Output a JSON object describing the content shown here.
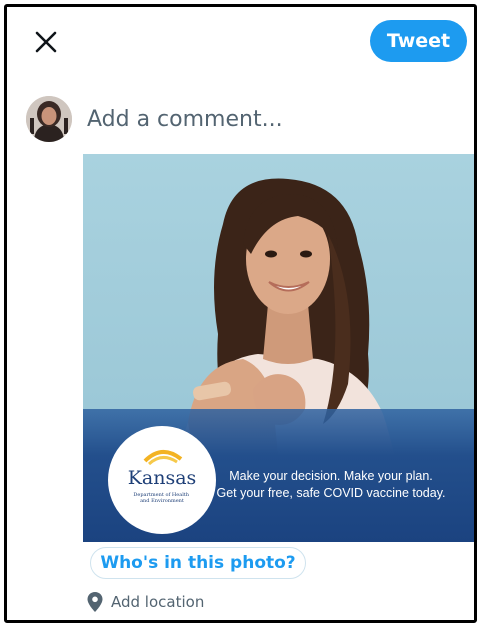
{
  "header": {
    "close_icon": "close-icon",
    "tweet_label": "Tweet",
    "accent_color": "#1d9bf0"
  },
  "composer": {
    "avatar_icon": "user-avatar",
    "placeholder": "Add a comment..."
  },
  "media": {
    "logo_text": "Kansas",
    "logo_subtext": "Department of Health\nand Environment",
    "caption_line1": "Make your decision. Make your plan.",
    "caption_line2": "Get your free, safe COVID vaccine today.",
    "banner_color": "#1f4a86"
  },
  "actions": {
    "tag_people_label": "Who's in this photo?",
    "location_icon": "map-pin-icon",
    "location_label": "Add location"
  }
}
